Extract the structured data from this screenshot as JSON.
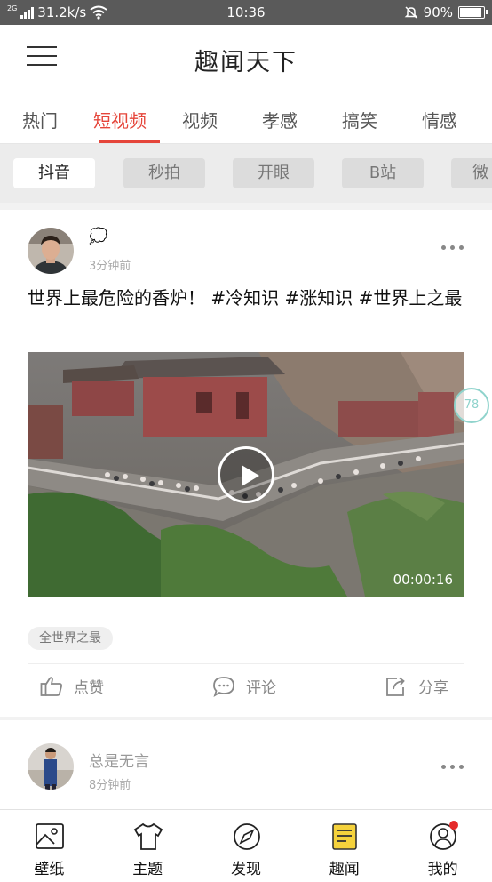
{
  "status_bar": {
    "network_type": "2G",
    "speed": "31.2k/s",
    "time": "10:36",
    "battery": "90%",
    "battery_level": 0.9
  },
  "header": {
    "title": "趣闻天下"
  },
  "tabs": [
    {
      "label": "热门"
    },
    {
      "label": "短视频",
      "active": true
    },
    {
      "label": "视频"
    },
    {
      "label": "孝感"
    },
    {
      "label": "搞笑"
    },
    {
      "label": "情感"
    }
  ],
  "chips": [
    {
      "label": "抖音",
      "active": true
    },
    {
      "label": "秒拍"
    },
    {
      "label": "开眼"
    },
    {
      "label": "B站"
    },
    {
      "label": "微"
    }
  ],
  "posts": [
    {
      "author": "💭",
      "time_ago": "3分钟前",
      "text": "世界上最危险的香炉！ #冷知识 #涨知识 #世界上之最",
      "video_duration": "00:00:16",
      "tag": "全世界之最",
      "actions": {
        "like": "点赞",
        "comment": "评论",
        "share": "分享"
      }
    },
    {
      "author": "总是无言",
      "time_ago": "8分钟前"
    }
  ],
  "side_badge": "78",
  "bottom_nav": [
    {
      "label": "壁纸",
      "icon": "image-icon"
    },
    {
      "label": "主题",
      "icon": "tshirt-icon"
    },
    {
      "label": "发现",
      "icon": "compass-icon"
    },
    {
      "label": "趣闻",
      "icon": "news-icon",
      "active": true
    },
    {
      "label": "我的",
      "icon": "user-icon",
      "badge_dot": true
    }
  ],
  "colors": {
    "accent": "#e5453a",
    "news_icon_yellow": "#f5d23c",
    "status_bar": "#5a5a5a"
  }
}
